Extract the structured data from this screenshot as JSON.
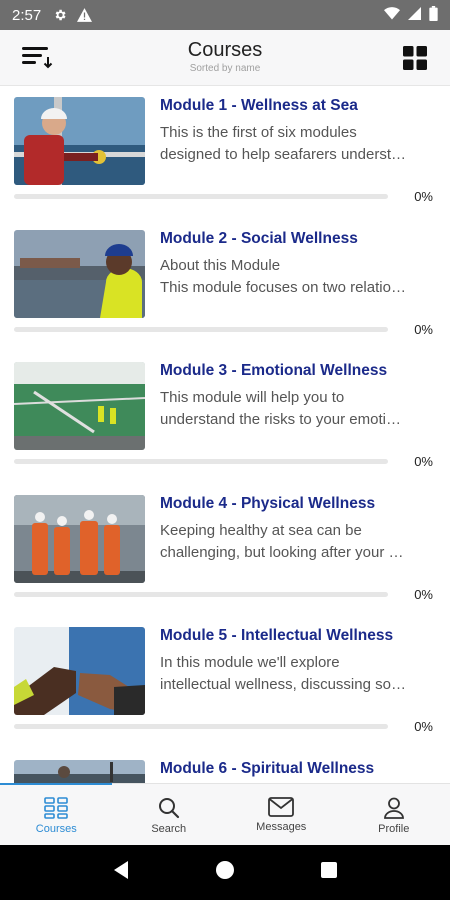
{
  "status_bar": {
    "time": "2:57"
  },
  "header": {
    "title": "Courses",
    "subtitle": "Sorted by name"
  },
  "courses": [
    {
      "title": "Module 1 - Wellness at Sea",
      "desc_line1": "This is the first of six modules",
      "desc_line2": "designed to help seafarers underst…",
      "progress_value": 0,
      "progress_text": "0%"
    },
    {
      "title": "Module 2 - Social Wellness",
      "desc_line1": "About this Module",
      "desc_line2": "This module focuses on two relatio…",
      "progress_value": 0,
      "progress_text": "0%"
    },
    {
      "title": "Module 3 - Emotional Wellness",
      "desc_line1": "This module will help you to",
      "desc_line2": "understand the risks to your emoti…",
      "progress_value": 0,
      "progress_text": "0%"
    },
    {
      "title": "Module 4 - Physical Wellness",
      "desc_line1": "Keeping healthy at sea can be",
      "desc_line2": "challenging, but looking after your …",
      "progress_value": 0,
      "progress_text": "0%"
    },
    {
      "title": "Module 5 - Intellectual Wellness",
      "desc_line1": "In this module we'll explore",
      "desc_line2": "intellectual wellness, discussing so…",
      "progress_value": 0,
      "progress_text": "0%"
    },
    {
      "title": "Module 6 - Spiritual Wellness",
      "desc_line1": "",
      "desc_line2": "",
      "progress_value": 0,
      "progress_text": ""
    }
  ],
  "tabs": [
    {
      "label": "Courses",
      "icon": "courses-icon",
      "active": true
    },
    {
      "label": "Search",
      "icon": "search-icon",
      "active": false
    },
    {
      "label": "Messages",
      "icon": "envelope-icon",
      "active": false
    },
    {
      "label": "Profile",
      "icon": "person-icon",
      "active": false
    }
  ],
  "colors": {
    "accent": "#2d8cd4",
    "title": "#1b2a8a",
    "status_bar": "#6e6e6e"
  }
}
